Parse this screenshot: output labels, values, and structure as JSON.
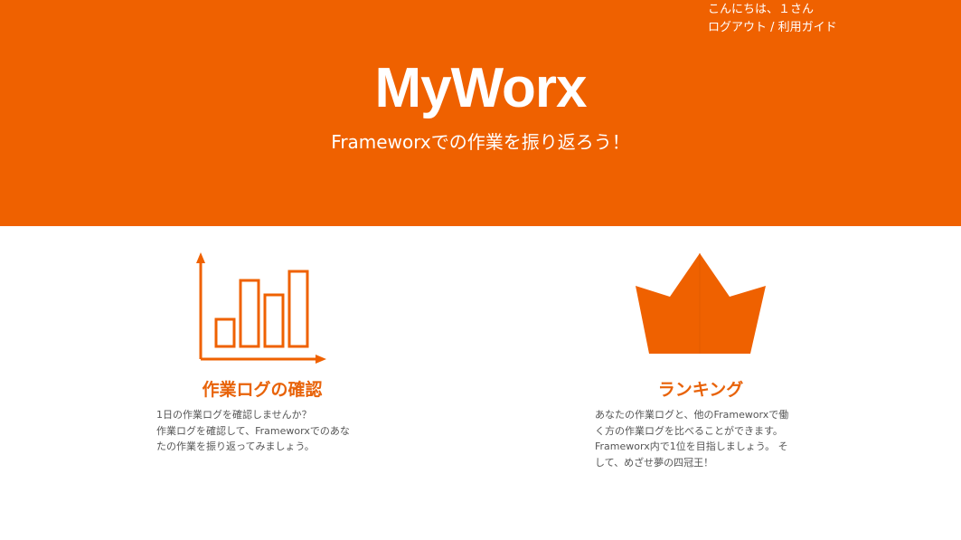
{
  "header": {
    "greeting": "こんにちは、１さん",
    "logout_label": "ログアウト",
    "separator": " / ",
    "guide_label": "利用ガイド",
    "title": "MyWorx",
    "subtitle": "Frameworxでの作業を振り返ろう！",
    "bg_color": "#ef6100"
  },
  "features": [
    {
      "icon": "bar-chart-icon",
      "title": "作業ログの確認",
      "lines": [
        "1日の作業ログを確認しませんか？",
        "作業ログを確認して、Frameworxでのあな",
        "たの作業を振り返ってみましょう。"
      ]
    },
    {
      "icon": "crown-icon",
      "title": "ランキング",
      "lines": [
        "あなたの作業ログと、他のFrameworxで働",
        "く方の作業ログを比べることができます。",
        "Frameworx内で1位を目指しましょう。 そ",
        "して、めざせ夢の四冠王！"
      ]
    }
  ],
  "accent_color": "#e8630a"
}
